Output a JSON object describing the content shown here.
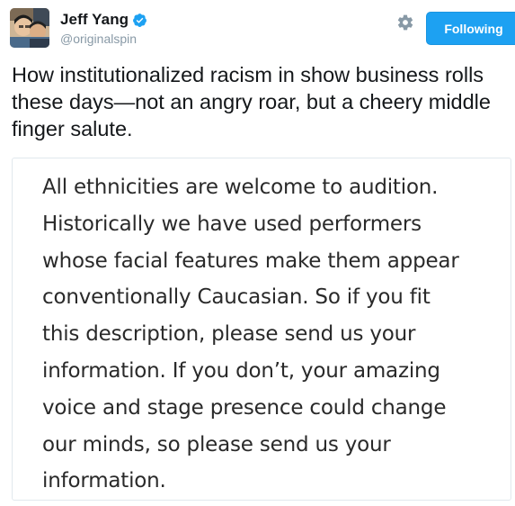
{
  "user": {
    "display_name": "Jeff Yang",
    "handle": "@originalspin",
    "verified": true
  },
  "actions": {
    "follow_label": "Following",
    "settings_icon": "gear-icon",
    "follow_color": "#1da1f2"
  },
  "tweet": {
    "text": "How institutionalized racism in show business rolls these days—not an angry roar, but a cheery middle finger salute."
  },
  "media": {
    "text": "All ethnicities are welcome to audition.\nHistorically we have used performers\nwhose facial features make them appear\nconventionally Caucasian.  So if you fit\nthis description, please send us your\ninformation.  If you don’t, your amazing\nvoice and stage presence could change\nour minds, so please send us your\ninformation."
  }
}
